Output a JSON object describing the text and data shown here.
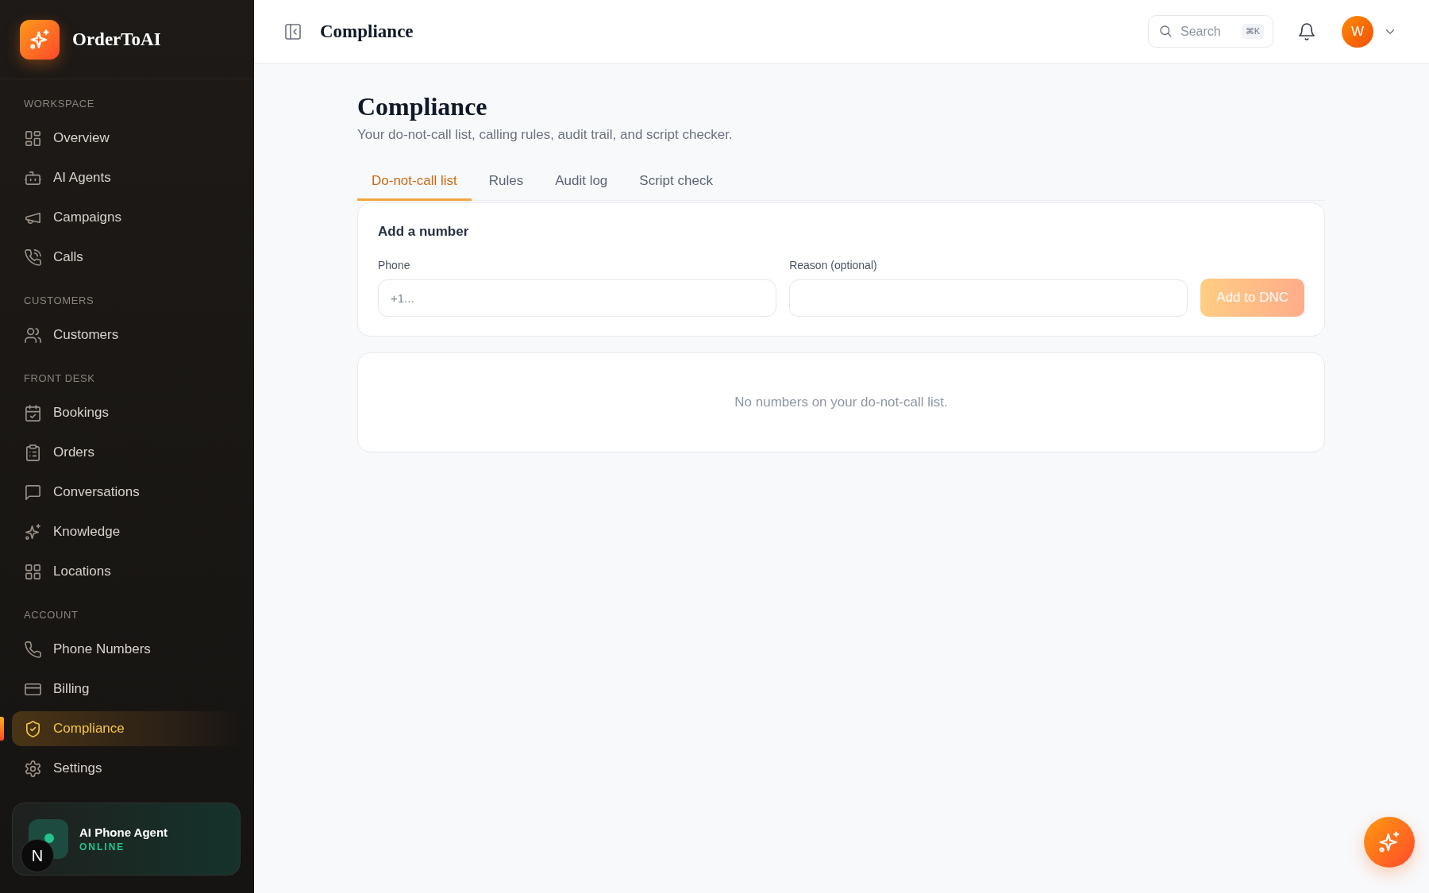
{
  "sidebar": {
    "brand": "OrderToAI",
    "sections": [
      {
        "label": "WORKSPACE",
        "items": [
          {
            "label": "Overview",
            "selected": false
          },
          {
            "label": "AI Agents",
            "selected": false
          },
          {
            "label": "Campaigns",
            "selected": false
          },
          {
            "label": "Calls",
            "selected": false
          }
        ]
      },
      {
        "label": "CUSTOMERS",
        "items": [
          {
            "label": "Customers",
            "selected": false
          }
        ]
      },
      {
        "label": "FRONT DESK",
        "items": [
          {
            "label": "Bookings",
            "selected": false
          },
          {
            "label": "Orders",
            "selected": false
          },
          {
            "label": "Conversations",
            "selected": false
          },
          {
            "label": "Knowledge",
            "selected": false
          },
          {
            "label": "Locations",
            "selected": false
          }
        ]
      },
      {
        "label": "ACCOUNT",
        "items": [
          {
            "label": "Phone Numbers",
            "selected": false
          },
          {
            "label": "Billing",
            "selected": false
          },
          {
            "label": "Compliance",
            "selected": true
          },
          {
            "label": "Settings",
            "selected": false
          }
        ]
      }
    ],
    "agent_card": {
      "name": "AI Phone Agent",
      "status": "ONLINE",
      "badge": "N"
    }
  },
  "header": {
    "title": "Compliance",
    "search": {
      "placeholder": "Search",
      "shortcut": "⌘K"
    },
    "avatar": "W"
  },
  "page": {
    "title": "Compliance",
    "subtitle": "Your do-not-call list, calling rules, audit trail, and script checker.",
    "tabs": [
      {
        "label": "Do-not-call list",
        "selected": true
      },
      {
        "label": "Rules",
        "selected": false
      },
      {
        "label": "Audit log",
        "selected": false
      },
      {
        "label": "Script check",
        "selected": false
      }
    ],
    "add_card": {
      "heading": "Add a number",
      "fields": [
        {
          "label": "Phone",
          "placeholder": "+1..."
        },
        {
          "label": "Reason (optional)"
        }
      ],
      "button": {
        "label": "Add to DNC",
        "disabled": true
      }
    },
    "empty_message": "No numbers on your do-not-call list."
  }
}
